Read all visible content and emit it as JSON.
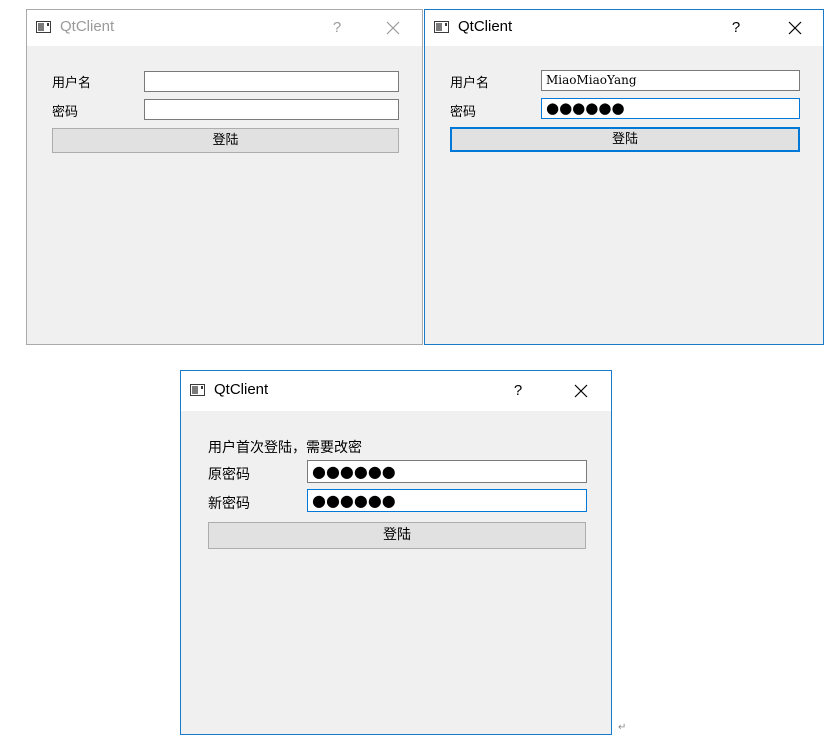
{
  "windows": [
    {
      "title": "QtClient",
      "help": "?",
      "username_label": "用户名",
      "password_label": "密码",
      "username_value": "",
      "password_value": "",
      "login_label": "登陆"
    },
    {
      "title": "QtClient",
      "help": "?",
      "username_label": "用户名",
      "password_label": "密码",
      "username_value": "MiaoMiaoYang",
      "password_value": "●●●●●●",
      "login_label": "登陆"
    },
    {
      "title": "QtClient",
      "help": "?",
      "notice": "用户首次登陆，需要改密",
      "old_password_label": "原密码",
      "new_password_label": "新密码",
      "old_password_value": "●●●●●●",
      "new_password_value": "●●●●●●",
      "login_label": "登陆"
    }
  ],
  "icons": {
    "app": "qt-window-icon",
    "close": "close-icon"
  },
  "colors": {
    "focus_border": "#0078d7",
    "window_bg": "#f0f0f0",
    "titlebar_bg": "#ffffff",
    "button_bg": "#e1e1e1"
  }
}
